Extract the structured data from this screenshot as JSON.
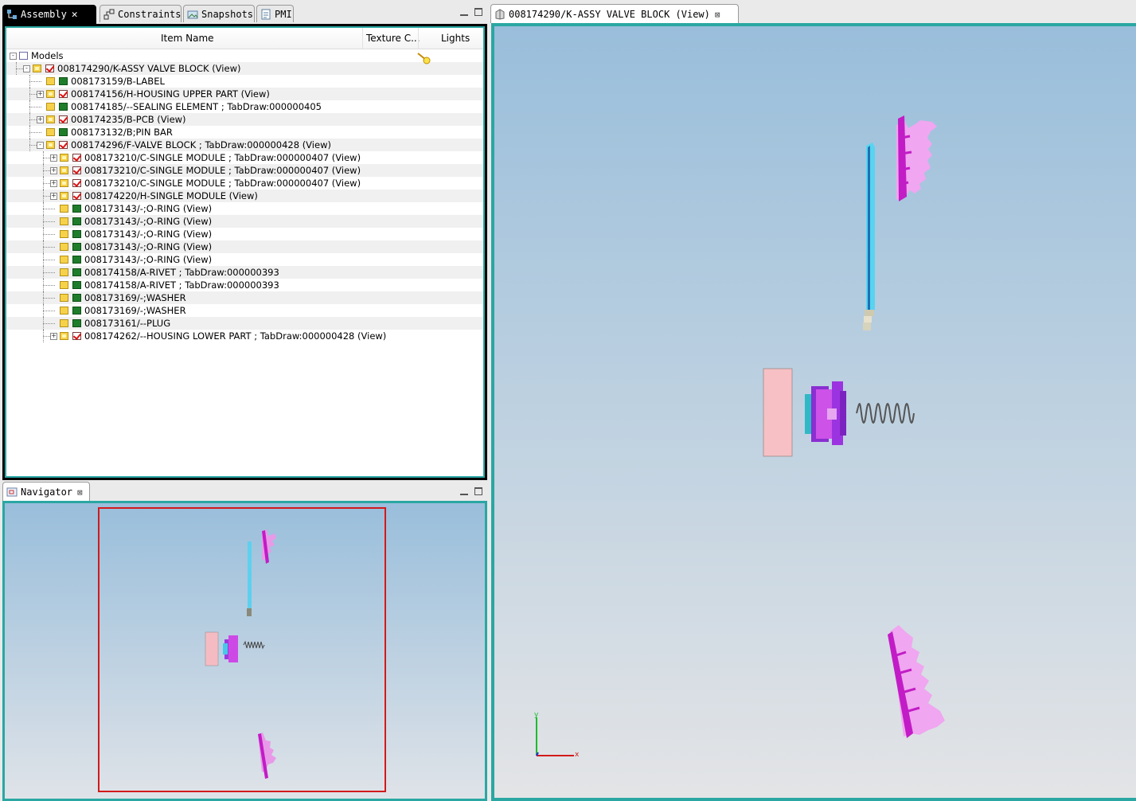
{
  "assembly_panel": {
    "tabs": [
      {
        "label": "Assembly",
        "icon": "assembly-icon",
        "active": true
      },
      {
        "label": "Constraints",
        "icon": "constraints-icon",
        "active": false
      },
      {
        "label": "Snapshots",
        "icon": "snapshots-icon",
        "active": false
      },
      {
        "label": "PMI",
        "icon": "pmi-icon",
        "active": false
      }
    ],
    "columns": {
      "name": "Item Name",
      "texture": "Texture C...",
      "lights": "Lights"
    },
    "tree": [
      {
        "label": "Models",
        "depth": 0,
        "expander": "-",
        "type": "model"
      },
      {
        "label": "008174290/K-ASSY VALVE BLOCK (View)",
        "depth": 1,
        "expander": "-",
        "type": "check"
      },
      {
        "label": "008173159/B-LABEL",
        "depth": 2,
        "expander": "",
        "type": "green"
      },
      {
        "label": "008174156/H-HOUSING UPPER PART (View)",
        "depth": 2,
        "expander": "+",
        "type": "check"
      },
      {
        "label": "008174185/--SEALING ELEMENT ; TabDraw:000000405",
        "depth": 2,
        "expander": "",
        "type": "green"
      },
      {
        "label": "008174235/B-PCB (View)",
        "depth": 2,
        "expander": "+",
        "type": "check"
      },
      {
        "label": "008173132/B;PIN BAR",
        "depth": 2,
        "expander": "",
        "type": "green"
      },
      {
        "label": "008174296/F-VALVE BLOCK ; TabDraw:000000428 (View)",
        "depth": 2,
        "expander": "-",
        "type": "check"
      },
      {
        "label": "008173210/C-SINGLE MODULE ; TabDraw:000000407 (View)",
        "depth": 3,
        "expander": "+",
        "type": "check"
      },
      {
        "label": "008173210/C-SINGLE MODULE ; TabDraw:000000407 (View)",
        "depth": 3,
        "expander": "+",
        "type": "check"
      },
      {
        "label": "008173210/C-SINGLE MODULE ; TabDraw:000000407 (View)",
        "depth": 3,
        "expander": "+",
        "type": "check"
      },
      {
        "label": "008174220/H-SINGLE MODULE (View)",
        "depth": 3,
        "expander": "+",
        "type": "check"
      },
      {
        "label": "008173143/-;O-RING (View)",
        "depth": 3,
        "expander": "",
        "type": "green"
      },
      {
        "label": "008173143/-;O-RING (View)",
        "depth": 3,
        "expander": "",
        "type": "green"
      },
      {
        "label": "008173143/-;O-RING (View)",
        "depth": 3,
        "expander": "",
        "type": "green"
      },
      {
        "label": "008173143/-;O-RING (View)",
        "depth": 3,
        "expander": "",
        "type": "green"
      },
      {
        "label": "008173143/-;O-RING (View)",
        "depth": 3,
        "expander": "",
        "type": "green"
      },
      {
        "label": "008174158/A-RIVET ; TabDraw:000000393",
        "depth": 3,
        "expander": "",
        "type": "green"
      },
      {
        "label": "008174158/A-RIVET ; TabDraw:000000393",
        "depth": 3,
        "expander": "",
        "type": "green"
      },
      {
        "label": "008173169/-;WASHER",
        "depth": 3,
        "expander": "",
        "type": "green"
      },
      {
        "label": "008173169/-;WASHER",
        "depth": 3,
        "expander": "",
        "type": "green"
      },
      {
        "label": "008173161/--PLUG",
        "depth": 3,
        "expander": "",
        "type": "green"
      },
      {
        "label": "008174262/--HOUSING LOWER PART ; TabDraw:000000428 (View)",
        "depth": 3,
        "expander": "+",
        "type": "check"
      }
    ]
  },
  "navigator_panel": {
    "tab_label": "Navigator",
    "icon": "navigator-icon"
  },
  "main_view": {
    "tab_label": "008174290/K-ASSY VALVE BLOCK (View)",
    "icon": "model-view-icon",
    "axis_y": "y",
    "axis_x": "x"
  },
  "colors": {
    "accent_frame": "#2aa7a3",
    "nav_rect": "#d21a1a",
    "part_magenta": "#d243d6",
    "part_purple": "#8a2fd1",
    "part_cyan": "#54d2ef"
  }
}
